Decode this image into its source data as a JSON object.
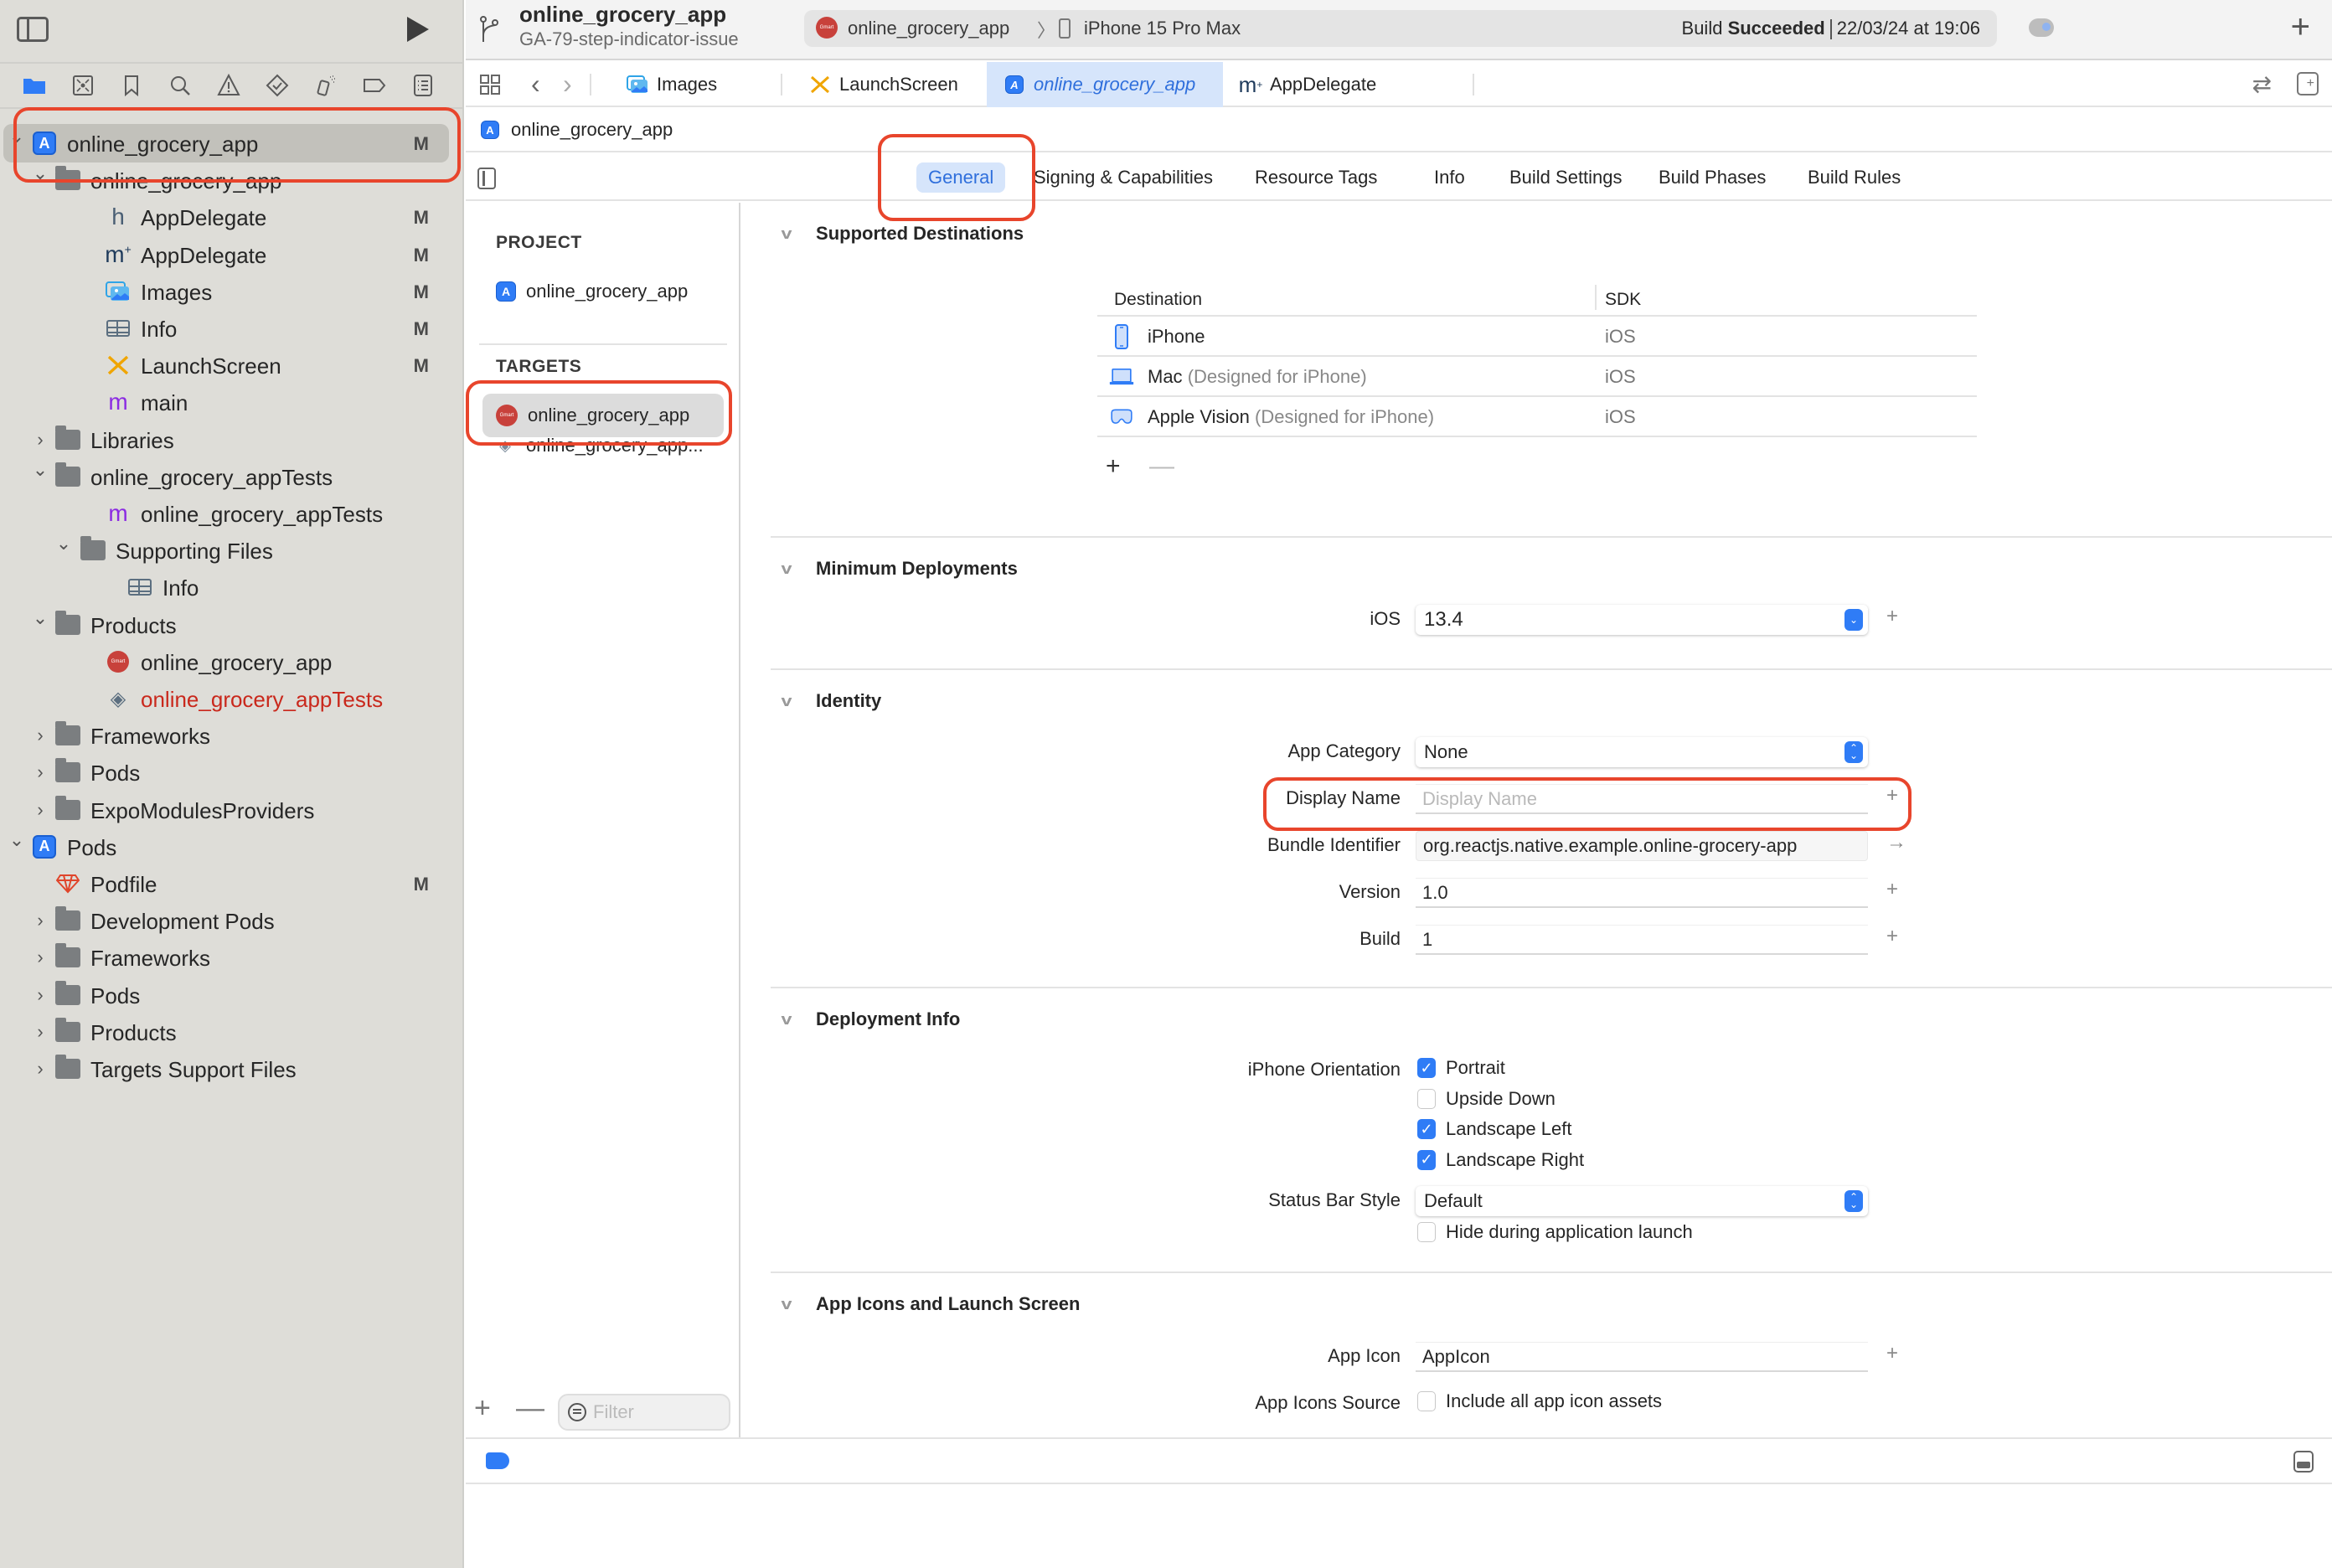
{
  "toolbar": {
    "project_title": "online_grocery_app",
    "branch": "GA-79-step-indicator-issue",
    "scheme": "online_grocery_app",
    "scheme_separator": "〉",
    "device": "iPhone 15 Pro Max",
    "build_status_prefix": "Build",
    "build_status_result": "Succeeded",
    "build_timestamp": "22/03/24 at 19:06",
    "add_label": "+"
  },
  "navigator": {
    "icons": [
      "folder-icon",
      "source-control-icon",
      "bookmark-icon",
      "search-icon",
      "warning-icon",
      "test-icon",
      "debug-icon",
      "breakpoint-icon",
      "report-icon"
    ],
    "tree": [
      {
        "label": "online_grocery_app",
        "badge": "M",
        "type": "project",
        "level": 0,
        "expanded": true,
        "selected": true
      },
      {
        "label": "online_grocery_app",
        "badge": "",
        "type": "folder",
        "level": 1,
        "expanded": true
      },
      {
        "label": "AppDelegate",
        "badge": "M",
        "type": "header",
        "level": 2
      },
      {
        "label": "AppDelegate",
        "badge": "M",
        "type": "objc-plus",
        "level": 2
      },
      {
        "label": "Images",
        "badge": "M",
        "type": "assets",
        "level": 2
      },
      {
        "label": "Info",
        "badge": "M",
        "type": "plist",
        "level": 2
      },
      {
        "label": "LaunchScreen",
        "badge": "M",
        "type": "storyboard",
        "level": 2
      },
      {
        "label": "main",
        "badge": "",
        "type": "objc",
        "level": 2
      },
      {
        "label": "Libraries",
        "badge": "",
        "type": "folder",
        "level": 1,
        "expanded": false
      },
      {
        "label": "online_grocery_appTests",
        "badge": "",
        "type": "folder",
        "level": 1,
        "expanded": true
      },
      {
        "label": "online_grocery_appTests",
        "badge": "",
        "type": "objc",
        "level": 2
      },
      {
        "label": "Supporting Files",
        "badge": "",
        "type": "folder",
        "level": 2,
        "expanded": true
      },
      {
        "label": "Info",
        "badge": "",
        "type": "plist",
        "level": 3
      },
      {
        "label": "Products",
        "badge": "",
        "type": "folder",
        "level": 1,
        "expanded": true
      },
      {
        "label": "online_grocery_app",
        "badge": "",
        "type": "app-product",
        "level": 2
      },
      {
        "label": "online_grocery_appTests",
        "badge": "",
        "type": "test-product",
        "level": 2,
        "missing": true
      },
      {
        "label": "Frameworks",
        "badge": "",
        "type": "folder",
        "level": 1,
        "expanded": false
      },
      {
        "label": "Pods",
        "badge": "",
        "type": "folder",
        "level": 1,
        "expanded": false
      },
      {
        "label": "ExpoModulesProviders",
        "badge": "",
        "type": "folder",
        "level": 1,
        "expanded": false
      },
      {
        "label": "Pods",
        "badge": "",
        "type": "project",
        "level": 0,
        "expanded": true
      },
      {
        "label": "Podfile",
        "badge": "M",
        "type": "ruby",
        "level": 1
      },
      {
        "label": "Development Pods",
        "badge": "",
        "type": "folder",
        "level": 1,
        "expanded": false
      },
      {
        "label": "Frameworks",
        "badge": "",
        "type": "folder",
        "level": 1,
        "expanded": false
      },
      {
        "label": "Pods",
        "badge": "",
        "type": "folder",
        "level": 1,
        "expanded": false
      },
      {
        "label": "Products",
        "badge": "",
        "type": "folder",
        "level": 1,
        "expanded": false
      },
      {
        "label": "Targets Support Files",
        "badge": "",
        "type": "folder",
        "level": 1,
        "expanded": false
      }
    ]
  },
  "tabs": [
    {
      "label": "Images",
      "icon": "assets-icon",
      "active": false
    },
    {
      "label": "LaunchScreen",
      "icon": "storyboard-icon",
      "active": false
    },
    {
      "label": "online_grocery_app",
      "icon": "project-icon",
      "active": true
    },
    {
      "label": "AppDelegate",
      "icon": "objc-plus-icon",
      "active": false
    }
  ],
  "breadcrumb": {
    "label": "online_grocery_app"
  },
  "settings_tabs": [
    {
      "label": "General",
      "active": true
    },
    {
      "label": "Signing & Capabilities",
      "active": false
    },
    {
      "label": "Resource Tags",
      "active": false
    },
    {
      "label": "Info",
      "active": false
    },
    {
      "label": "Build Settings",
      "active": false
    },
    {
      "label": "Build Phases",
      "active": false
    },
    {
      "label": "Build Rules",
      "active": false
    }
  ],
  "targets_panel": {
    "project_header": "PROJECT",
    "project_item": "online_grocery_app",
    "targets_header": "TARGETS",
    "targets": [
      {
        "label": "online_grocery_app",
        "selected": true
      },
      {
        "label": "online_grocery_app..."
      }
    ],
    "filter_placeholder": "Filter",
    "add_label": "+",
    "remove_label": "—"
  },
  "general": {
    "supported_destinations": {
      "title": "Supported Destinations",
      "columns": [
        "Destination",
        "SDK"
      ],
      "rows": [
        {
          "name": "iPhone",
          "qualifier": "",
          "sdk": "iOS",
          "icon": "iphone-icon"
        },
        {
          "name": "Mac",
          "qualifier": "(Designed for iPhone)",
          "sdk": "iOS",
          "icon": "mac-icon"
        },
        {
          "name": "Apple Vision",
          "qualifier": "(Designed for iPhone)",
          "sdk": "iOS",
          "icon": "vision-pro-icon"
        }
      ],
      "add_label": "+",
      "remove_label": "—"
    },
    "minimum_deployments": {
      "title": "Minimum Deployments",
      "label": "iOS",
      "value": "13.4"
    },
    "identity": {
      "title": "Identity",
      "app_category_label": "App Category",
      "app_category_value": "None",
      "display_name_label": "Display Name",
      "display_name_value": "",
      "display_name_placeholder": "Display Name",
      "bundle_id_label": "Bundle Identifier",
      "bundle_id_value": "org.reactjs.native.example.online-grocery-app",
      "version_label": "Version",
      "version_value": "1.0",
      "build_label": "Build",
      "build_value": "1"
    },
    "deployment_info": {
      "title": "Deployment Info",
      "orientation_label": "iPhone Orientation",
      "orientations": [
        {
          "label": "Portrait",
          "checked": true
        },
        {
          "label": "Upside Down",
          "checked": false
        },
        {
          "label": "Landscape Left",
          "checked": true
        },
        {
          "label": "Landscape Right",
          "checked": true
        }
      ],
      "status_bar_label": "Status Bar Style",
      "status_bar_value": "Default",
      "hide_status_bar_label": "Hide during application launch",
      "hide_status_bar_checked": false
    },
    "app_icons": {
      "title": "App Icons and Launch Screen",
      "app_icon_label": "App Icon",
      "app_icon_value": "AppIcon",
      "app_icons_source_label": "App Icons Source",
      "include_all_label": "Include all app icon assets",
      "include_all_checked": false
    }
  },
  "colors": {
    "accent": "#2f7cf6",
    "annotation": "#e8452c",
    "missing_file": "#c9281c",
    "navigator_bg": "#deddd8"
  }
}
